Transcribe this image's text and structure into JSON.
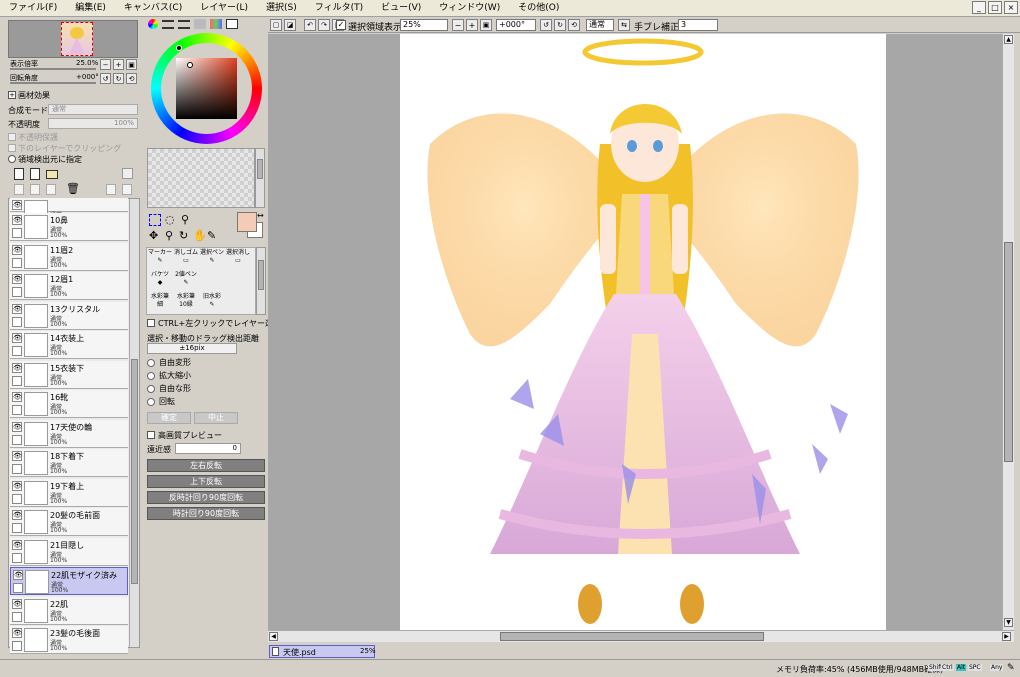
{
  "menu": [
    "ファイル(F)",
    "編集(E)",
    "キャンバス(C)",
    "レイヤー(L)",
    "選択(S)",
    "フィルタ(T)",
    "ビュー(V)",
    "ウィンドウ(W)",
    "その他(O)"
  ],
  "window_buttons": [
    "_",
    "□",
    "×"
  ],
  "toolbar": {
    "selection_view_label": "選択領域表示",
    "zoom_value": "25%",
    "rotation_value": "+000°",
    "blend_value": "通常",
    "stabilizer_label": "手ブレ補正",
    "stabilizer_value": "3"
  },
  "navigator": {
    "zoom_label": "表示倍率",
    "zoom_value": "25.0%",
    "rotation_label": "回転角度",
    "rotation_value": "+000°"
  },
  "layer_props": {
    "paper_effect": "画材効果",
    "blend_mode_label": "合成モード",
    "blend_mode_value": "通常",
    "opacity_label": "不透明度",
    "opacity_value": "100%",
    "preserve_opacity": "不透明保護",
    "clipping": "下のレイヤーでクリッピング",
    "selection_source": "領域検出元に指定"
  },
  "layers": [
    {
      "name": "",
      "mode": "通常",
      "opacity": "100%"
    },
    {
      "name": "10鼻",
      "mode": "通常",
      "opacity": "100%"
    },
    {
      "name": "11眉2",
      "mode": "通常",
      "opacity": "100%"
    },
    {
      "name": "12眉1",
      "mode": "通常",
      "opacity": "100%"
    },
    {
      "name": "13クリスタル",
      "mode": "通常",
      "opacity": "100%"
    },
    {
      "name": "14衣装上",
      "mode": "通常",
      "opacity": "100%"
    },
    {
      "name": "15衣装下",
      "mode": "通常",
      "opacity": "100%"
    },
    {
      "name": "16靴",
      "mode": "通常",
      "opacity": "100%"
    },
    {
      "name": "17天使の輪",
      "mode": "通常",
      "opacity": "100%"
    },
    {
      "name": "18下着下",
      "mode": "通常",
      "opacity": "100%"
    },
    {
      "name": "19下着上",
      "mode": "通常",
      "opacity": "100%"
    },
    {
      "name": "20髪の毛前面",
      "mode": "通常",
      "opacity": "100%"
    },
    {
      "name": "21目隠し",
      "mode": "通常",
      "opacity": "100%"
    },
    {
      "name": "22肌モザイク済み",
      "mode": "通常",
      "opacity": "100%"
    },
    {
      "name": "22肌",
      "mode": "通常",
      "opacity": "100%"
    },
    {
      "name": "23髪の毛後面",
      "mode": "通常",
      "opacity": "100%"
    }
  ],
  "tools": {
    "marker": "マーカー",
    "eraser": "消しゴム",
    "sel_pen": "選択ペン",
    "sel_erase": "選択消し",
    "bucket": "バケツ",
    "binary_pen": "2値ペン",
    "watercolor1": "水彩筆",
    "watercolor1_sub": "細",
    "watercolor2": "水彩筆",
    "watercolor2_sub": "10縁",
    "old_water": "旧水彩"
  },
  "transform": {
    "ctrl_click": "CTRL+左クリックでレイヤー選択",
    "drag_label": "選択・移動のドラッグ検出距離",
    "drag_value": "±16pix",
    "free_transform": "自由変形",
    "scale": "拡大縮小",
    "free_shape": "自由な形",
    "rotate": "回転",
    "ok": "確定",
    "cancel": "中止",
    "hq_preview": "高画質プレビュー",
    "perspective_label": "遠近感",
    "perspective_value": "0",
    "flip_h": "左右反転",
    "flip_v": "上下反転",
    "rot_ccw": "反時計回り90度回転",
    "rot_cw": "時計回り90度回転"
  },
  "document_tab": {
    "name": "天使.psd",
    "zoom": "25%"
  },
  "status": {
    "memory": "メモリ負荷率:45% (456MB使用/948MB確保)",
    "keys": [
      "Shift",
      "Ctrl",
      "Alt",
      "SPC",
      "Any"
    ]
  },
  "colors": {
    "current": "#f4cbb6",
    "panel": "#d4d0c8",
    "canvas_bg": "#a7a7a7"
  }
}
